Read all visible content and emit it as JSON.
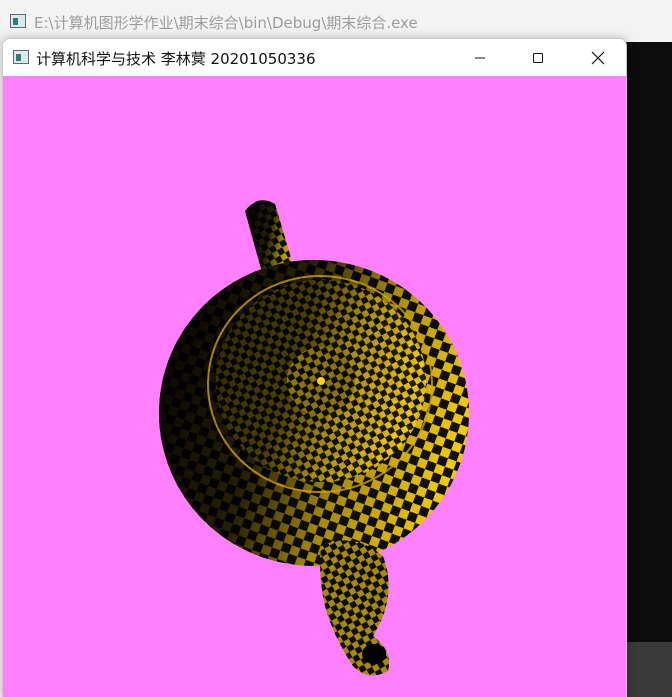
{
  "console_window": {
    "title": "E:\\计算机图形学作业\\期末综合\\bin\\Debug\\期末综合.exe"
  },
  "gl_window": {
    "title": "计算机科学与技术 李林蓂 20201050336",
    "background_color": "#ff80ff",
    "controls": {
      "minimize": "—",
      "maximize": "☐",
      "close": "✕"
    }
  },
  "scene": {
    "object": "checkered-teapot",
    "checker_colors": [
      "#111111",
      "#ffe600"
    ]
  }
}
